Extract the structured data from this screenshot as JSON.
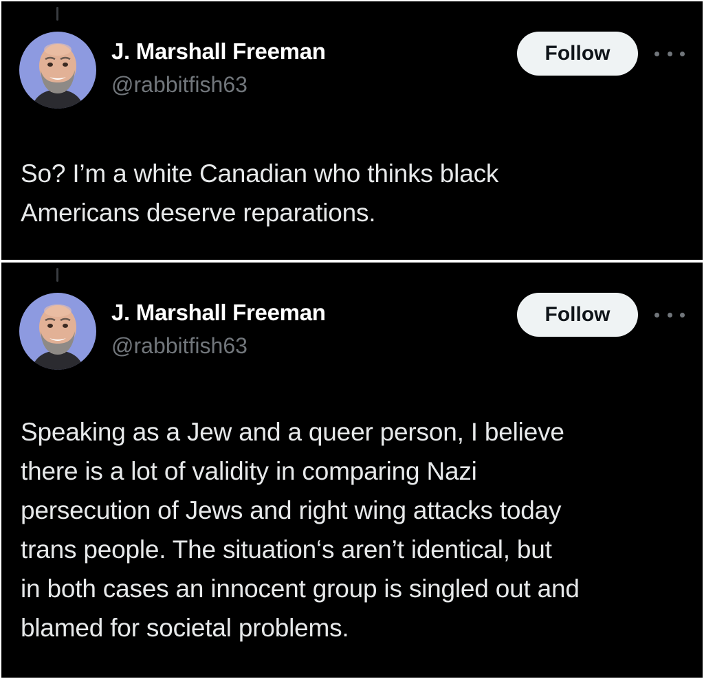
{
  "tweets": [
    {
      "author_name": "J. Marshall Freeman",
      "author_handle": "@rabbitfish63",
      "follow_label": "Follow",
      "text_lines": [
        "So? I’m a white Canadian who thinks black",
        "Americans deserve reparations."
      ]
    },
    {
      "author_name": "J. Marshall Freeman",
      "author_handle": "@rabbitfish63",
      "follow_label": "Follow",
      "text_lines": [
        "Speaking as a Jew and a queer person, I believe",
        "there is a lot of validity in comparing Nazi",
        "persecution of Jews and right wing attacks today",
        "trans people. The situation‘s aren’t identical, but",
        "in both cases an innocent group is singled out and",
        "blamed for societal problems."
      ]
    }
  ],
  "icons": {
    "more": "more-horizontal-icon",
    "avatar": "avatar-photo"
  },
  "colors": {
    "background": "#000000",
    "text": "#e7e9ea",
    "secondary_text": "#71767b",
    "follow_button_bg": "#eff3f4",
    "follow_button_text": "#0f1419",
    "avatar_bg": "#8d9ae0"
  }
}
